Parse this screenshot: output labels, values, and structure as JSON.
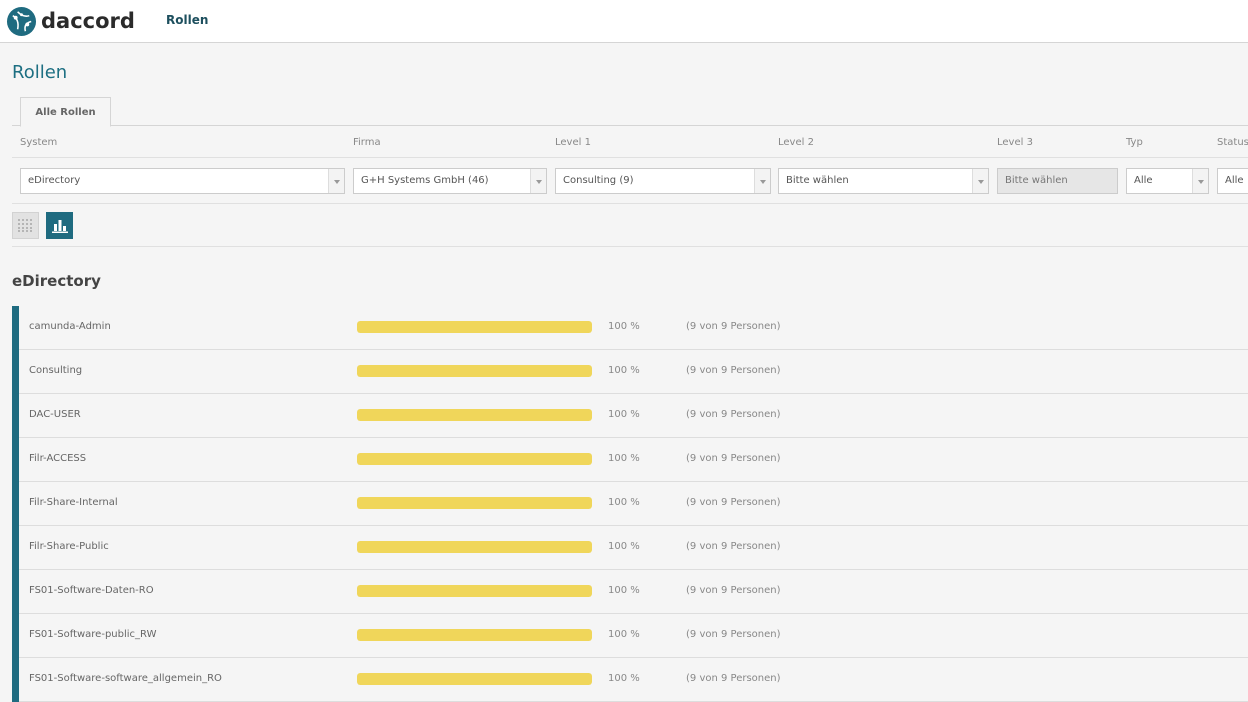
{
  "header": {
    "logo_text": "daccord",
    "nav_item": "Rollen"
  },
  "page": {
    "title": "Rollen",
    "tab_label": "Alle Rollen"
  },
  "filters": {
    "labels": [
      "System",
      "Firma",
      "Level 1",
      "Level 2",
      "Level 3",
      "Typ",
      "Status"
    ],
    "system": "eDirectory",
    "firma": "G+H Systems GmbH (46)",
    "level1": "Consulting (9)",
    "level2": "Bitte wählen",
    "level3": "Bitte wählen",
    "typ": "Alle",
    "status": "Alle"
  },
  "view_toggle": {
    "grid_icon": "grid-icon",
    "chart_icon": "bar-chart-icon",
    "active": "chart"
  },
  "section": {
    "title": "eDirectory"
  },
  "roles": [
    {
      "name": "camunda-Admin",
      "percent": 100,
      "percent_label": "100 %",
      "count_label": "(9 von 9 Personen)"
    },
    {
      "name": "Consulting",
      "percent": 100,
      "percent_label": "100 %",
      "count_label": "(9 von 9 Personen)"
    },
    {
      "name": "DAC-USER",
      "percent": 100,
      "percent_label": "100 %",
      "count_label": "(9 von 9 Personen)"
    },
    {
      "name": "Filr-ACCESS",
      "percent": 100,
      "percent_label": "100 %",
      "count_label": "(9 von 9 Personen)"
    },
    {
      "name": "Filr-Share-Internal",
      "percent": 100,
      "percent_label": "100 %",
      "count_label": "(9 von 9 Personen)"
    },
    {
      "name": "Filr-Share-Public",
      "percent": 100,
      "percent_label": "100 %",
      "count_label": "(9 von 9 Personen)"
    },
    {
      "name": "FS01-Software-Daten-RO",
      "percent": 100,
      "percent_label": "100 %",
      "count_label": "(9 von 9 Personen)"
    },
    {
      "name": "FS01-Software-public_RW",
      "percent": 100,
      "percent_label": "100 %",
      "count_label": "(9 von 9 Personen)"
    },
    {
      "name": "FS01-Software-software_allgemein_RO",
      "percent": 100,
      "percent_label": "100 %",
      "count_label": "(9 von 9 Personen)"
    }
  ],
  "colors": {
    "accent": "#1f6b80",
    "bar": "#f0d65a",
    "title": "#1d6f82"
  }
}
